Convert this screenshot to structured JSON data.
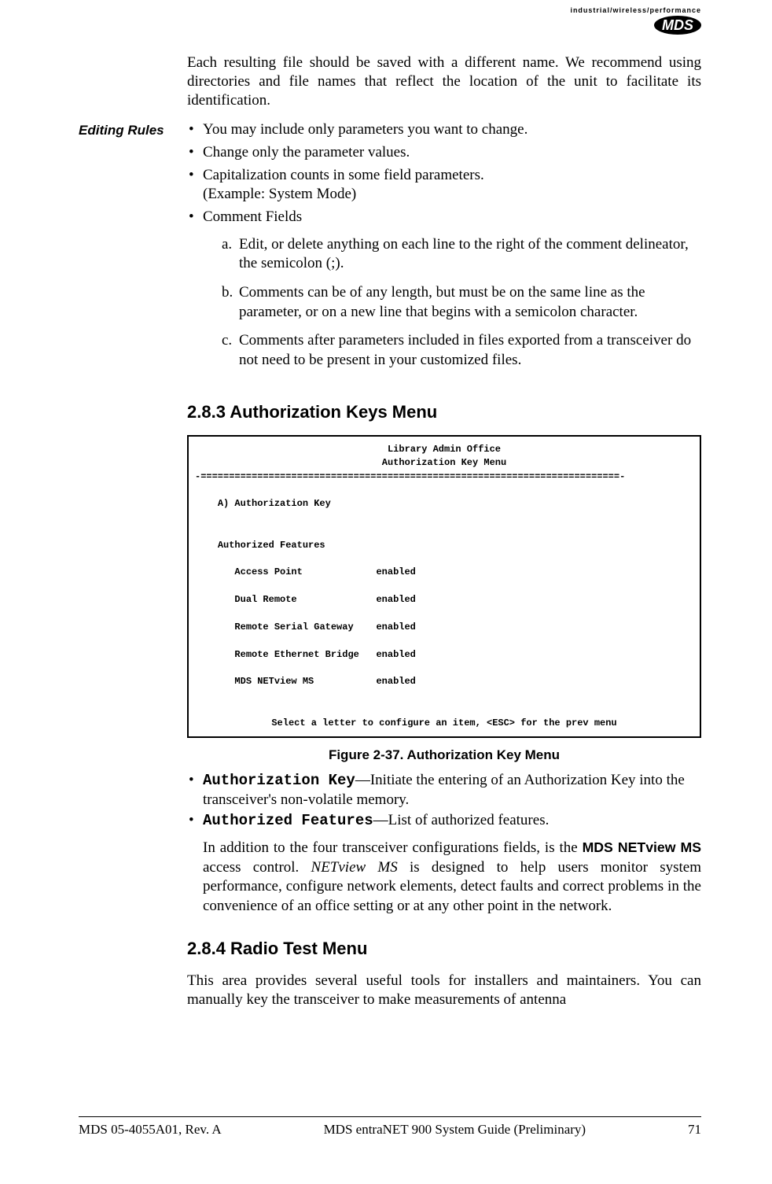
{
  "header": {
    "tagline": "industrial/wireless/performance",
    "logo": "MDS"
  },
  "intro_para": "Each resulting file should be saved with a different name. We recommend using directories and file names that reflect the location of the unit to facilitate its identification.",
  "editing_rules": {
    "label": "Editing Rules",
    "items": [
      "You may include only parameters you want to change.",
      "Change only the parameter values.",
      "Capitalization counts in some field parameters.\n(Example: System Mode)",
      "Comment Fields"
    ],
    "sub_a": "Edit, or delete anything on each line to the right of the comment delineator, the semicolon (;).",
    "sub_b": "Comments can be of any length, but must be on the same line as the parameter, or on a new line that begins with a semicolon character.",
    "sub_c": "Comments after parameters included in files exported from a transceiver do not need to be present in your customized files."
  },
  "sec_283_title": "2.8.3 Authorization Keys Menu",
  "terminal": {
    "title1": "Library Admin Office",
    "title2": "Authorization Key Menu",
    "hr": "-==========================================================================-",
    "item_a": "A) Authorization Key",
    "feat_hdr": "Authorized Features",
    "rows": [
      {
        "name": "Access Point",
        "status": "enabled"
      },
      {
        "name": "Dual Remote",
        "status": "enabled"
      },
      {
        "name": "Remote Serial Gateway",
        "status": "enabled"
      },
      {
        "name": "Remote Ethernet Bridge",
        "status": "enabled"
      },
      {
        "name": "MDS NETview MS",
        "status": "enabled"
      }
    ],
    "footer": "Select a letter to configure an item, <ESC> for the prev menu"
  },
  "fig_caption": "Figure 2-37. Authorization Key Menu",
  "defs": {
    "ak_term": "Authorization Key",
    "ak_text": "—Initiate the entering of an Authorization Key into the transceiver's non-volatile memory.",
    "af_term": "Authorized Features",
    "af_text": "—List of authorized features.",
    "extra_pre": "In addition to the four transceiver configurations fields, is the ",
    "extra_bold": "MDS NETview MS",
    "extra_mid": " access control. ",
    "extra_ital": "NETview MS",
    "extra_post": " is designed to help users monitor system performance, configure network elements, detect faults and correct problems in the convenience of an office setting or at any other point in the network."
  },
  "sec_284_title": "2.8.4 Radio Test Menu",
  "sec_284_para": "This area provides several useful tools for installers and maintainers. You can manually key the transceiver to make measurements of antenna",
  "footer": {
    "left": "MDS 05-4055A01, Rev. A",
    "center": "MDS entraNET 900 System Guide (Preliminary)",
    "right": "71"
  }
}
